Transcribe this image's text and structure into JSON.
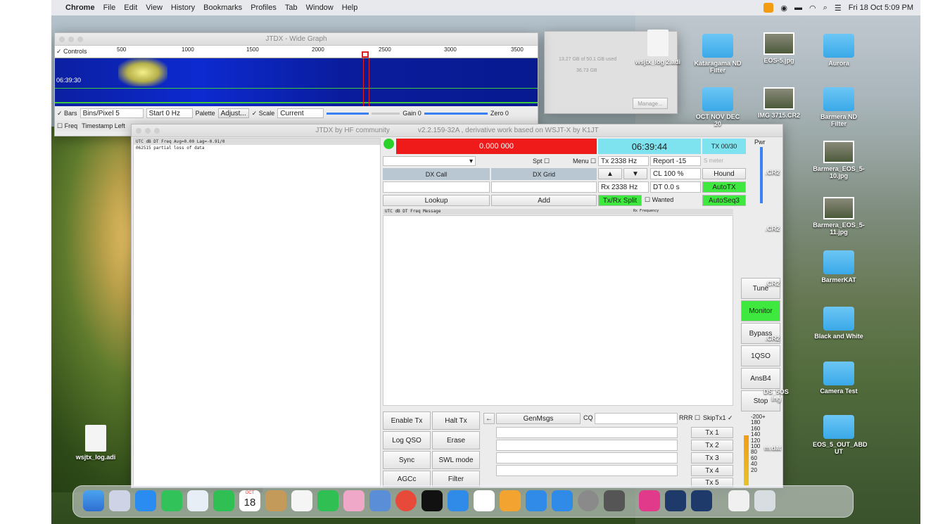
{
  "menubar": {
    "app": "Chrome",
    "items": [
      "File",
      "Edit",
      "View",
      "History",
      "Bookmarks",
      "Profiles",
      "Tab",
      "Window",
      "Help"
    ],
    "clock": "Fri 18 Oct 5:09 PM"
  },
  "widegraph": {
    "title": "JTDX - Wide Graph",
    "controls_label": "Controls",
    "scale_ticks": [
      "500",
      "1000",
      "1500",
      "2000",
      "2500",
      "3000",
      "3500"
    ],
    "time_label": "06:39:30",
    "bars_label": "Bars",
    "bins_label": "Bins/Pixel 5",
    "start_label": "Start 0 Hz",
    "palette_label": "Palette",
    "adjust_label": "Adjust...",
    "scale_label": "Scale",
    "current_label": "Current",
    "gain_label": "Gain 0",
    "zero_label": "Zero 0",
    "freq_label": "Freq",
    "timestamp_label": "Timestamp Left"
  },
  "bg_window": {
    "text1": "13.27 GB of 50.1 GB used",
    "text2": "36.73 GB",
    "manage": "Manage..."
  },
  "jtdx": {
    "title": "JTDX by HF community",
    "version": "v2.2.159-32A , derivative work based on WSJT-X by K1JT",
    "band_header": "UTC    dB   DT Freq   Avg=0.00 Lag=-0.91/0",
    "band_line": "062515  partial loss of data",
    "freq_display": "0.000 000",
    "clock": "06:39:44",
    "tx_status": "TX 00/30",
    "pwr_label": "Pwr",
    "spt_label": "Spt",
    "menu_label": "Menu",
    "tx_hz": "Tx 2338 Hz",
    "report": "Report -15",
    "mute": "S meter",
    "dx_call_label": "DX Call",
    "dx_grid_label": "DX Grid",
    "cl_label": "CL 100 %",
    "hound_label": "Hound",
    "rx_hz": "Rx 2338 Hz",
    "dt_label": "DT 0.0 s",
    "autotx_label": "AutoTX",
    "lookup_label": "Lookup",
    "add_label": "Add",
    "split_label": "Tx/Rx Split",
    "wanted_label": "Wanted",
    "autoseq_label": "AutoSeq3",
    "rx_header": "UTC    dB   DT Freq   Message",
    "rx_freq_label": "Rx Frequency",
    "side_buttons": [
      "Tune",
      "Monitor",
      "Bypass",
      "1QSO",
      "AnsB4",
      "Stop"
    ],
    "enable_tx": "Enable Tx",
    "halt_tx": "Halt Tx",
    "log_qso": "Log QSO",
    "erase": "Erase",
    "sync": "Sync",
    "swl_mode": "SWL mode",
    "agcc": "AGCc",
    "filter": "Filter",
    "genmsgs": "GenMsgs",
    "cq": "CQ",
    "rrr": "RRR",
    "skiptx1": "SkipTx1",
    "tx_buttons": [
      "Tx 1",
      "Tx 2",
      "Tx 3",
      "Tx 4",
      "Tx 5"
    ],
    "meter_labels": [
      "-200+",
      "180",
      "160",
      "140",
      "120",
      "100",
      "80",
      "60",
      "40",
      "20"
    ]
  },
  "desktop": {
    "icons": [
      {
        "label": "wsjtx_log 2.adi"
      },
      {
        "label": "Kataragama ND Filter"
      },
      {
        "label": "EOS-5.jpg"
      },
      {
        "label": "Aurora"
      },
      {
        "label": "OCT NOV DEC 20"
      },
      {
        "label": "IMG 3715.CR2"
      },
      {
        "label": "Barmera ND Filter"
      },
      {
        "label": ".CR2"
      },
      {
        "label": "Barmera_EOS_5-10.jpg"
      },
      {
        "label": ".CR2"
      },
      {
        "label": "Barmera_EOS_5-11.jpg"
      },
      {
        "label": ".CR2"
      },
      {
        "label": "BarmerKAT"
      },
      {
        "label": ".CR2"
      },
      {
        "label": "Black and White"
      },
      {
        "label": "DS_5OS ing"
      },
      {
        "label": "Camera Test"
      },
      {
        "label": "m.dat"
      },
      {
        "label": "EOS_5_OUT_ABD UT"
      },
      {
        "label": "wsjtx_log.adi"
      }
    ]
  },
  "dock": {
    "calendar_month": "OCT",
    "calendar_day": "18"
  }
}
